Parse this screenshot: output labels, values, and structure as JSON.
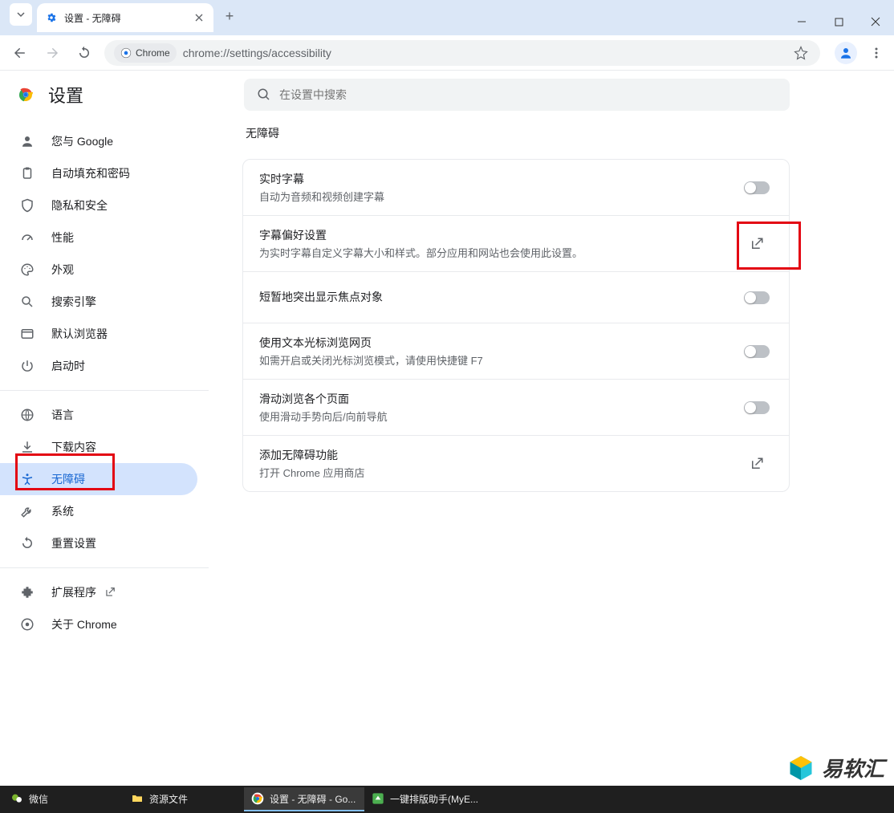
{
  "browser": {
    "tab_title": "设置 - 无障碍",
    "addr_chip": "Chrome",
    "url": "chrome://settings/accessibility"
  },
  "settings": {
    "title": "设置",
    "search_placeholder": "在设置中搜索",
    "section_title": "无障碍"
  },
  "sidebar": {
    "items": [
      {
        "label": "您与 Google"
      },
      {
        "label": "自动填充和密码"
      },
      {
        "label": "隐私和安全"
      },
      {
        "label": "性能"
      },
      {
        "label": "外观"
      },
      {
        "label": "搜索引擎"
      },
      {
        "label": "默认浏览器"
      },
      {
        "label": "启动时"
      }
    ],
    "items2": [
      {
        "label": "语言"
      },
      {
        "label": "下载内容"
      },
      {
        "label": "无障碍"
      },
      {
        "label": "系统"
      },
      {
        "label": "重置设置"
      }
    ],
    "items3": [
      {
        "label": "扩展程序"
      },
      {
        "label": "关于 Chrome"
      }
    ]
  },
  "rows": [
    {
      "title": "实时字幕",
      "sub": "自动为音频和视频创建字幕",
      "action": "toggle"
    },
    {
      "title": "字幕偏好设置",
      "sub": "为实时字幕自定义字幕大小和样式。部分应用和网站也会使用此设置。",
      "action": "external"
    },
    {
      "title": "短暂地突出显示焦点对象",
      "sub": "",
      "action": "toggle"
    },
    {
      "title": "使用文本光标浏览网页",
      "sub": "如需开启或关闭光标浏览模式，请使用快捷键 F7",
      "action": "toggle"
    },
    {
      "title": "滑动浏览各个页面",
      "sub": "使用滑动手势向后/向前导航",
      "action": "toggle"
    },
    {
      "title": "添加无障碍功能",
      "sub": "打开 Chrome 应用商店",
      "action": "external"
    }
  ],
  "taskbar": {
    "items": [
      {
        "label": "微信"
      },
      {
        "label": "资源文件"
      },
      {
        "label": "设置 - 无障碍 - Go..."
      },
      {
        "label": "一键排版助手(MyE..."
      }
    ]
  },
  "watermark": "易软汇"
}
